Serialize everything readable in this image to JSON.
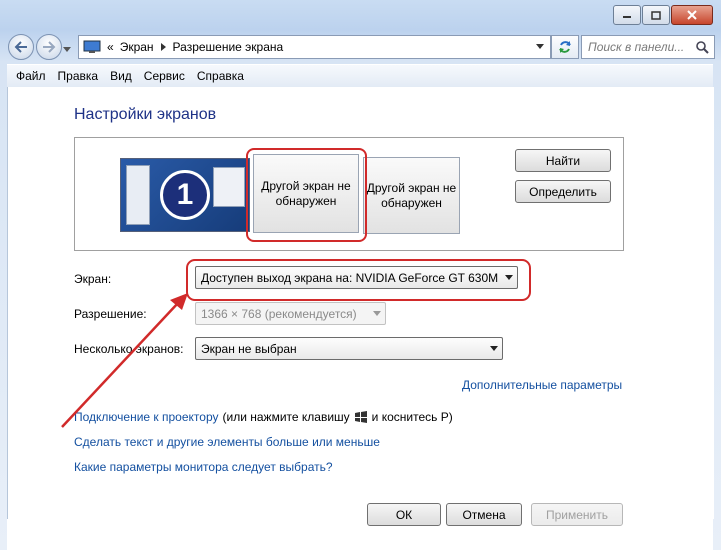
{
  "address": {
    "prefix": "«",
    "crumb1": "Экран",
    "crumb2": "Разрешение экрана"
  },
  "search": {
    "placeholder": "Поиск в панели..."
  },
  "menu": [
    "Файл",
    "Правка",
    "Вид",
    "Сервис",
    "Справка"
  ],
  "page": {
    "title": "Настройки экранов"
  },
  "preview": {
    "monitor1_number": "1",
    "monitor2_text": "Другой экран не обнаружен",
    "monitor3_text": "Другой экран не обнаружен"
  },
  "buttons": {
    "find": "Найти",
    "identify": "Определить",
    "ok": "ОК",
    "cancel": "Отмена",
    "apply": "Применить"
  },
  "fields": {
    "display_label": "Экран:",
    "display_value": "Доступен выход экрана на: NVIDIA GeForce GT 630M",
    "resolution_label": "Разрешение:",
    "resolution_value": "1366 × 768 (рекомендуется)",
    "multi_label": "Несколько экранов:",
    "multi_value": "Экран не выбран"
  },
  "links": {
    "advanced": "Дополнительные параметры",
    "projector": "Подключение к проектору",
    "projector_hint_a": "(или нажмите клавишу",
    "projector_hint_b": "и коснитесь P)",
    "text_size": "Сделать текст и другие элементы больше или меньше",
    "which_settings": "Какие параметры монитора следует выбрать?"
  },
  "colors": {
    "link": "#1450a0",
    "title": "#1e3287",
    "highlight": "#d12a2a"
  }
}
